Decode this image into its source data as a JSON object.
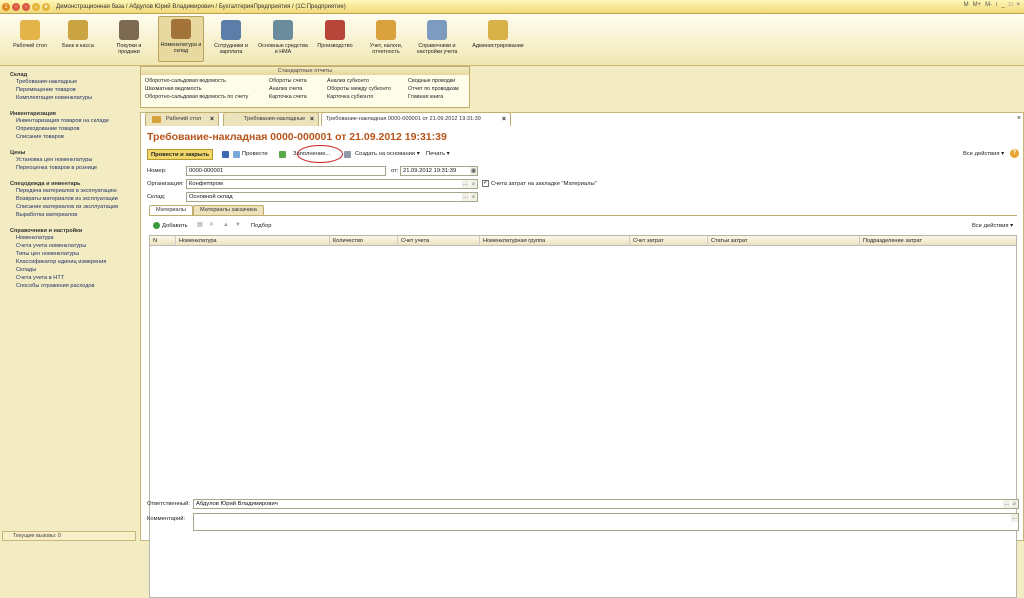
{
  "titlebar": {
    "text": "Демонстрационная база / Абдулов Юрий Владимирович / БухгалтерияПредприятия / (1С:Предприятие)",
    "icons": [
      "app-icon",
      "back-icon",
      "forward-icon",
      "home-icon",
      "star-icon"
    ],
    "controls": [
      "M",
      "M+",
      "M-",
      "i",
      "_",
      "□",
      "×"
    ]
  },
  "ribbon": {
    "sections": [
      {
        "label": "Рабочий стол"
      },
      {
        "label": "Банк и касса"
      },
      {
        "label": "Покупки и продажи"
      },
      {
        "label": "Номенклатура и склад"
      },
      {
        "label": "Сотрудники и зарплата"
      },
      {
        "label": "Основные средства и НМА"
      },
      {
        "label": "Производство"
      },
      {
        "label": "Учет, налоги, отчетность"
      },
      {
        "label": "Справочники и настройки учета"
      },
      {
        "label": "Администрирование"
      }
    ]
  },
  "reports": {
    "title": "Стандартные отчеты",
    "col1": [
      "Оборотно-сальдовая ведомость",
      "Шахматная ведомость",
      "Оборотно-сальдовая ведомость по счету"
    ],
    "col2": [
      "Обороты счета",
      "Анализ счета",
      "Карточка счета"
    ],
    "col3": [
      "Анализ субконто",
      "Обороты между субконто",
      "Карточка субконто"
    ],
    "col4": [
      "Сводные проводки",
      "Отчет по проводкам",
      "Главная книга"
    ]
  },
  "sidebar": {
    "sections": [
      {
        "title": "Склад",
        "items": [
          "Требования-накладные",
          "Перемещение товаров",
          "Комплектация номенклатуры"
        ]
      },
      {
        "title": "Инвентаризация",
        "items": [
          "Инвентаризация товаров на складе",
          "Оприходование товаров",
          "Списание товаров"
        ]
      },
      {
        "title": "Цены",
        "items": [
          "Установка цен номенклатуры",
          "Переоценка товаров в рознице"
        ]
      },
      {
        "title": "Спецодежда и инвентарь",
        "items": [
          "Передача материалов в эксплуатацию",
          "Возвраты материалов из эксплуатации",
          "Списание материалов из эксплуатации",
          "Выработка материалов"
        ]
      },
      {
        "title": "Справочники и настройки",
        "items": [
          "Номенклатура",
          "Счета учета номенклатуры",
          "Типы цен номенклатуры",
          "Классификатор единиц измерения",
          "Склады",
          "Счета учета в НТТ",
          "Способы отражения расходов"
        ]
      }
    ],
    "calls": "Текущие вызовы: 0"
  },
  "tabs": [
    {
      "label": "Рабочий стол"
    },
    {
      "label": "Требования-накладные"
    },
    {
      "label": "Требование-накладная 0000-000001 от 21.09.2012 19:31:39"
    }
  ],
  "doc": {
    "title": "Требование-накладная 0000-000001 от 21.09.2012 19:31:39",
    "toolbar": {
      "post_close": "Провести и закрыть",
      "post": "Провести",
      "fill": "Заполнение...",
      "create_based": "Создать на основании",
      "print": "Печать",
      "all_actions": "Все действия"
    },
    "number_label": "Номер:",
    "number": "0000-000001",
    "date_label": "от:",
    "date": "21.09.2012 19:31:39",
    "org_label": "Организация:",
    "org": "Конфетпром",
    "cost_checkbox": "Счета затрат на закладке \"Материалы\"",
    "cost_checked": true,
    "warehouse_label": "Склад:",
    "warehouse": "Основной склад",
    "subtabs": [
      "Материалы",
      "Материалы заказчика"
    ],
    "grid_toolbar": {
      "add": "Добавить",
      "pick": "Подбор",
      "all_actions": "Все действия"
    },
    "columns": [
      "N",
      "Номенклатура",
      "Количество",
      "Счет учета",
      "Номенклатурная группа",
      "Счет затрат",
      "Статьи затрат",
      "Подразделение затрат"
    ],
    "responsible_label": "Ответственный:",
    "responsible": "Абдулов Юрий Владимирович",
    "comment_label": "Комментарий:",
    "comment": ""
  }
}
